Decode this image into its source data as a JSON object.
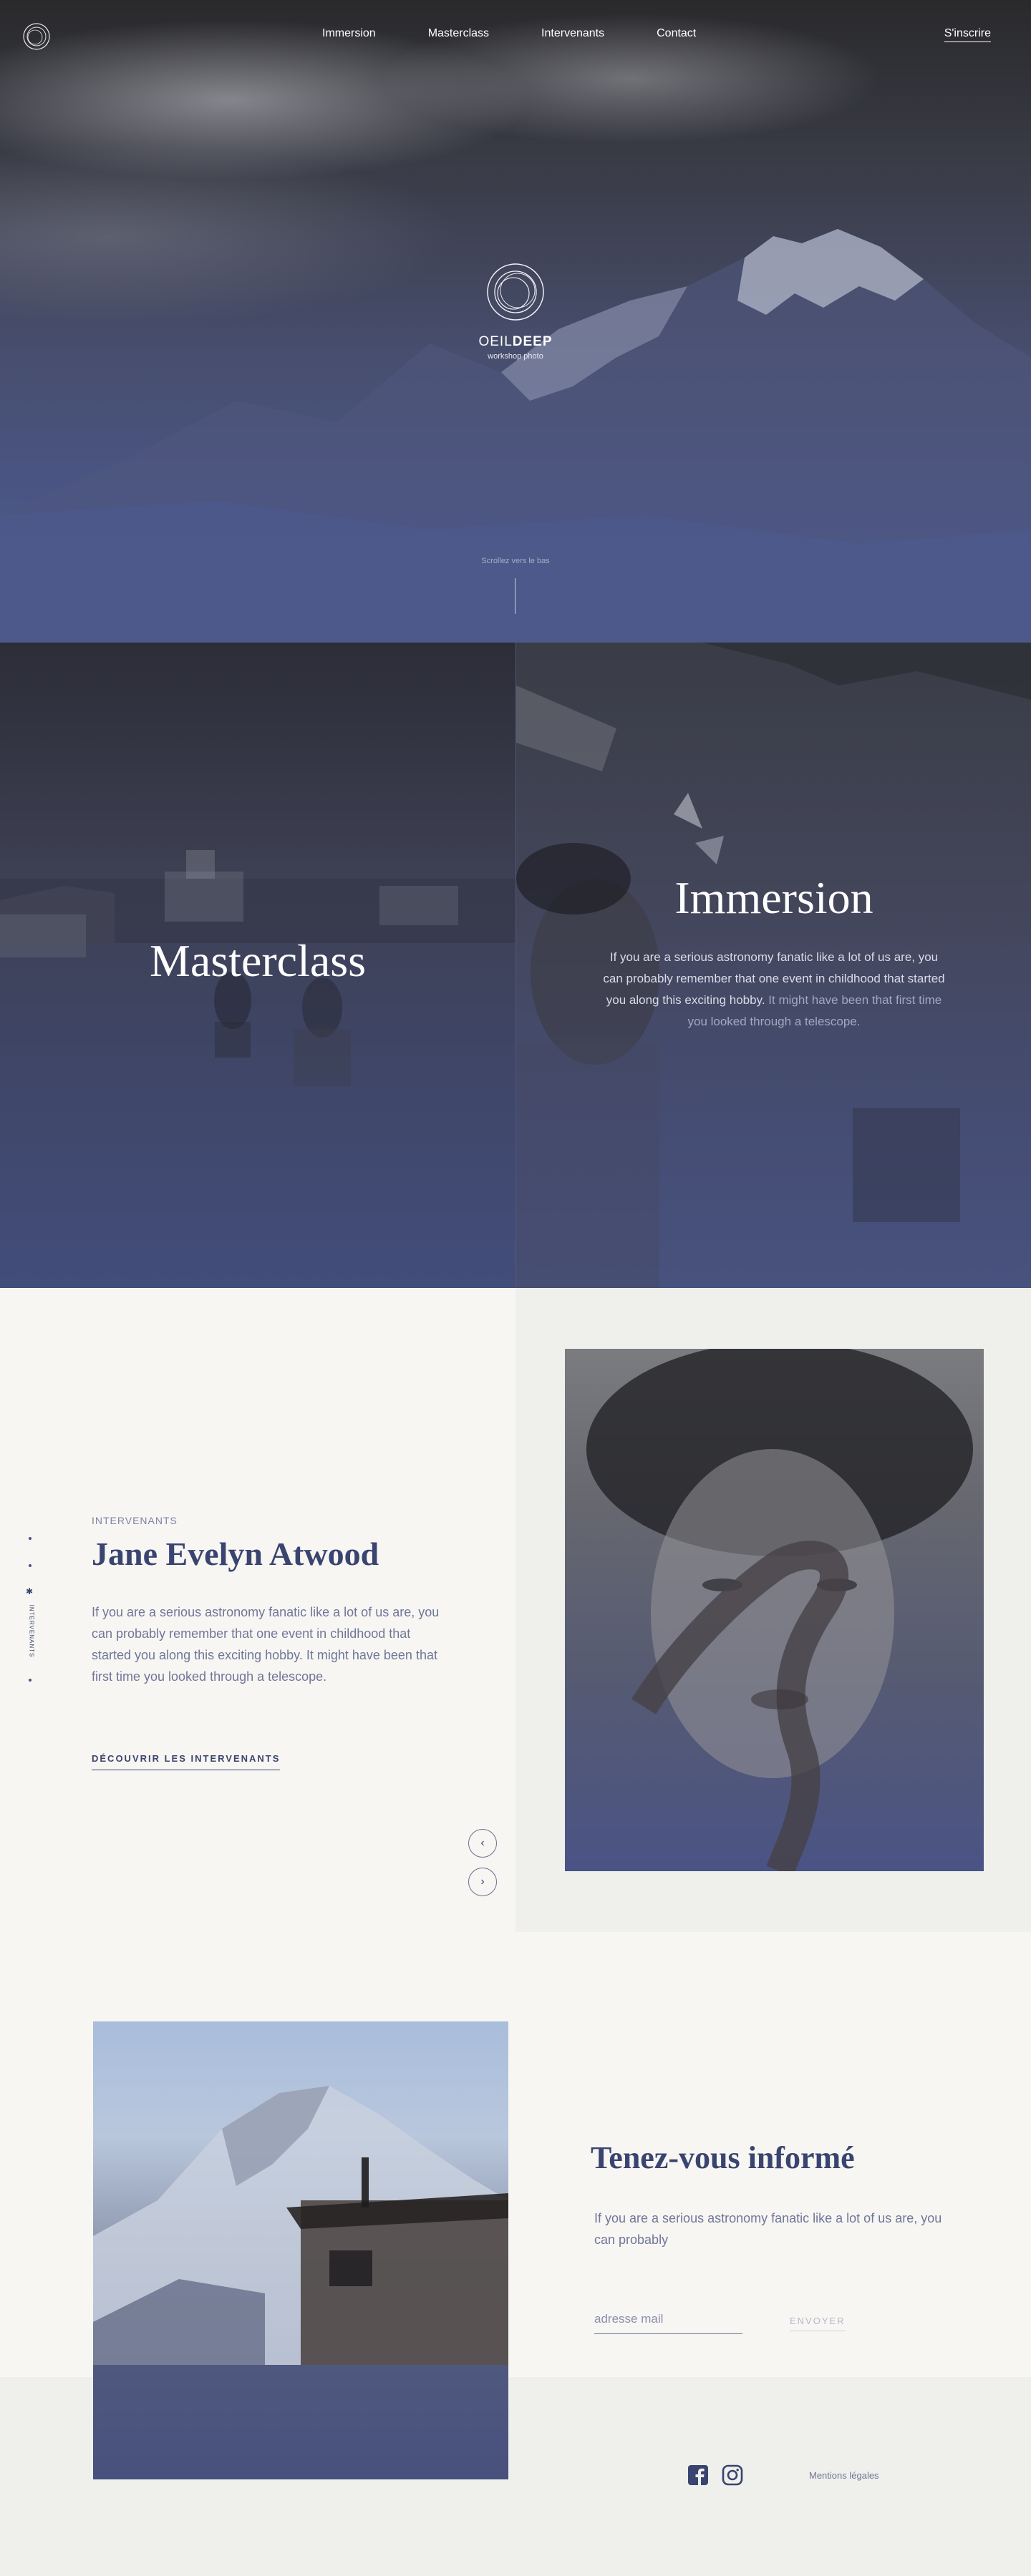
{
  "nav": {
    "links": [
      "Immersion",
      "Masterclass",
      "Intervenants",
      "Contact"
    ],
    "signup": "S'inscrire"
  },
  "hero": {
    "brand_thin": "OEIL",
    "brand_bold": "DEEP",
    "brand_sub": "workshop photo",
    "scroll_hint": "Scrollez vers le bas"
  },
  "tiles": {
    "masterclass_title": "Masterclass",
    "immersion_title": "Immersion",
    "immersion_text": "If you are a serious astronomy fanatic like a lot of us are, you can probably remember that one event in childhood that started you along this exciting hobby.",
    "immersion_text_faded": "It might have been that first time you looked through a telescope."
  },
  "speakers": {
    "eyebrow": "INTERVENANTS",
    "name": "Jane Evelyn Atwood",
    "text": "If you are a serious astronomy fanatic like a lot of us are, you can probably remember that one event in childhood that started you along this exciting hobby. It might have been that first time you looked through a telescope.",
    "link": "DÉCOUVRIR LES INTERVENANTS",
    "side_label": "INTERVENANTS",
    "prev_icon": "chevron-left-icon",
    "next_icon": "chevron-right-icon"
  },
  "newsletter": {
    "title": "Tenez-vous informé",
    "text": "If you are a serious astronomy fanatic like a lot of us are, you can probably",
    "placeholder": "adresse mail",
    "send": "ENVOYER"
  },
  "footer": {
    "social_icons": [
      "facebook-icon",
      "instagram-icon"
    ],
    "legal": "Mentions légales"
  },
  "colors": {
    "navy": "#3a4470",
    "muted": "#6f769a",
    "cream": "#f7f6f2",
    "light": "#efefeb"
  }
}
